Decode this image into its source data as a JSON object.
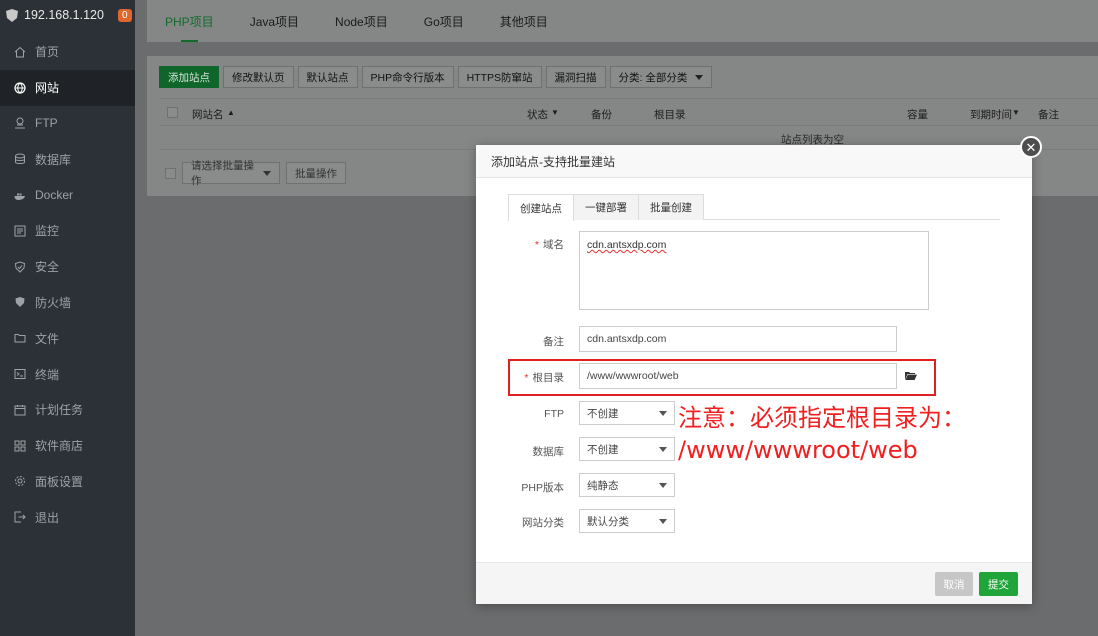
{
  "sidebar": {
    "host": "192.168.1.120",
    "badge": "0",
    "items": [
      {
        "label": "首页",
        "icon": "home-icon"
      },
      {
        "label": "网站",
        "icon": "globe-icon",
        "active": true
      },
      {
        "label": "FTP",
        "icon": "ftp-icon"
      },
      {
        "label": "数据库",
        "icon": "database-icon"
      },
      {
        "label": "Docker",
        "icon": "docker-icon"
      },
      {
        "label": "监控",
        "icon": "monitor-icon"
      },
      {
        "label": "安全",
        "icon": "shield-icon"
      },
      {
        "label": "防火墙",
        "icon": "firewall-icon"
      },
      {
        "label": "文件",
        "icon": "folder-icon"
      },
      {
        "label": "终端",
        "icon": "terminal-icon"
      },
      {
        "label": "计划任务",
        "icon": "calendar-icon"
      },
      {
        "label": "软件商店",
        "icon": "apps-icon"
      },
      {
        "label": "面板设置",
        "icon": "gear-icon"
      },
      {
        "label": "退出",
        "icon": "logout-icon"
      }
    ]
  },
  "tabs": [
    "PHP项目",
    "Java项目",
    "Node项目",
    "Go项目",
    "其他项目"
  ],
  "toolbar": {
    "add_site": "添加站点",
    "edit_default": "修改默认页",
    "default_site": "默认站点",
    "php_cli": "PHP命令行版本",
    "https_guard": "HTTPS防窜站",
    "vuln_scan": "漏洞扫描",
    "category_select": "分类: 全部分类"
  },
  "table": {
    "col_name": "网站名",
    "col_status": "状态",
    "col_backup": "备份",
    "col_root": "根目录",
    "col_capacity": "容量",
    "col_expire": "到期时间",
    "col_remark": "备注",
    "empty": "站点列表为空"
  },
  "bulk": {
    "select_placeholder": "请选择批量操作",
    "button": "批量操作"
  },
  "dialog": {
    "title": "添加站点-支持批量建站",
    "tabs": [
      "创建站点",
      "一键部署",
      "批量创建"
    ],
    "domain_label": "域名",
    "domain_value": "cdn.antsxdp.com",
    "remark_label": "备注",
    "remark_value": "cdn.antsxdp.com",
    "root_label": "根目录",
    "root_value": "/www/wwwroot/web",
    "ftp_label": "FTP",
    "ftp_value": "不创建",
    "db_label": "数据库",
    "db_value": "不创建",
    "php_label": "PHP版本",
    "php_value": "纯静态",
    "category_label": "网站分类",
    "category_value": "默认分类",
    "cancel": "取消",
    "submit": "提交"
  },
  "annotation": {
    "line1": "注意：必须指定根目录为：",
    "line2": "/www/wwwroot/web"
  },
  "colors": {
    "accent": "#20a53a",
    "annotation": "#f02020",
    "sidebar_bg": "#2c3137"
  }
}
